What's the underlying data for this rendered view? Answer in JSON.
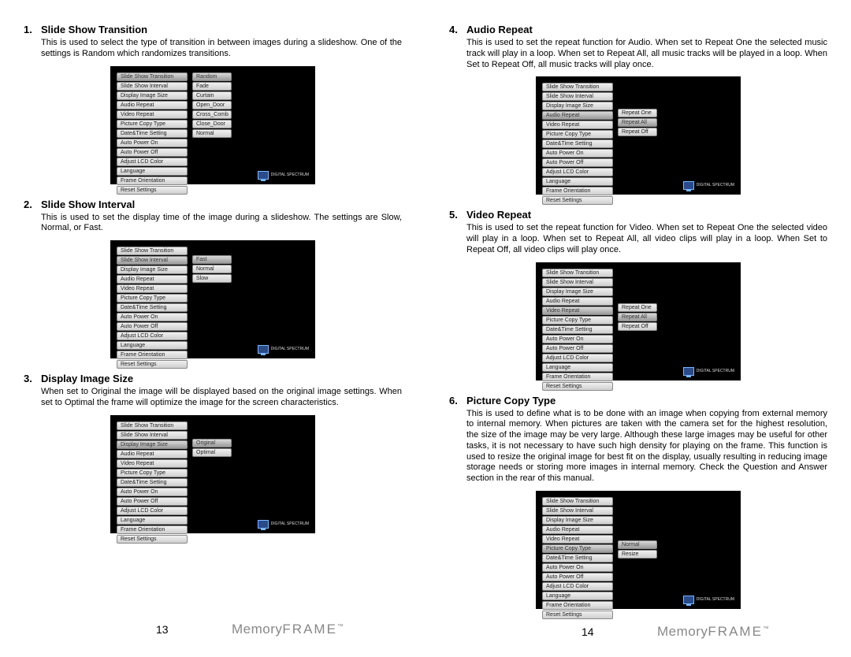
{
  "menuItems": [
    "Slide Show Transition",
    "Slide Show Interval",
    "Display Image Size",
    "Audio Repeat",
    "Video Repeat",
    "Picture Copy Type",
    "Date&Time Setting",
    "Auto Power On",
    "Auto Power Off",
    "Adjust LCD Color",
    "Language",
    "Frame Orientation",
    "Reset Settings"
  ],
  "sections": [
    {
      "num": "1.",
      "title": "Slide Show Transition",
      "body": "This is used to select the type of transition in between images during a slideshow. One of the settings is Random which randomizes transitions.",
      "sel": 0,
      "right": [
        "Random",
        "Fade",
        "Curtain",
        "Open_Door",
        "Cross_Comb",
        "Close_Door",
        "Normal"
      ],
      "rsel": 0
    },
    {
      "num": "2.",
      "title": "Slide Show Interval",
      "body": "This is used to set the display time of the image during a slideshow. The settings are Slow, Normal, or Fast.",
      "sel": 1,
      "right": [
        "Fast",
        "Normal",
        "Slow"
      ],
      "rsel": 0
    },
    {
      "num": "3.",
      "title": "Display Image Size",
      "body": "When set to Original the image will be displayed based on the original image settings. When set to Optimal the frame will optimize the image for the screen characteristics.",
      "sel": 2,
      "right": [
        "Original",
        "Optimal"
      ],
      "rsel": 0
    },
    {
      "num": "4.",
      "title": "Audio Repeat",
      "body": "This is used to set the repeat function for Audio. When set to Repeat One the selected music track will play in a loop. When set to Repeat All, all music tracks will be played in a loop. When Set to Repeat Off, all music tracks will play once.",
      "sel": 3,
      "right": [
        "Repeat One",
        "Repeat All",
        "Repeat Off"
      ],
      "rsel": 1
    },
    {
      "num": "5.",
      "title": "Video Repeat",
      "body": "This is used to set the repeat function for Video. When set to Repeat One the selected video will play in a loop. When set to Repeat All, all video clips will play in a loop. When Set to Repeat Off, all video clips will play once.",
      "sel": 4,
      "right": [
        "Repeat One",
        "Repeat All",
        "Repeat Off"
      ],
      "rsel": 1
    },
    {
      "num": "6.",
      "title": "Picture Copy Type",
      "body": "This is used to define what is to be done with an image when copying from external memory to internal memory. When pictures are taken with the camera set for the highest resolution, the size of the image may be very large. Although these large images may be useful for other tasks, it is not necessary to have such high density for playing on the frame. This function is used to resize the original image for best fit on the display, usually resulting in reducing image storage needs or storing more images in internal memory. Check the Question and Answer section in the rear of this manual.",
      "sel": 5,
      "right": [
        "Normal",
        "Resize"
      ],
      "rsel": 0
    }
  ],
  "pages": {
    "left": "13",
    "right": "14"
  },
  "brand": {
    "a": "Memory",
    "b": "FRAME"
  },
  "dsLogo": "DIGITAL SPECTRUM"
}
